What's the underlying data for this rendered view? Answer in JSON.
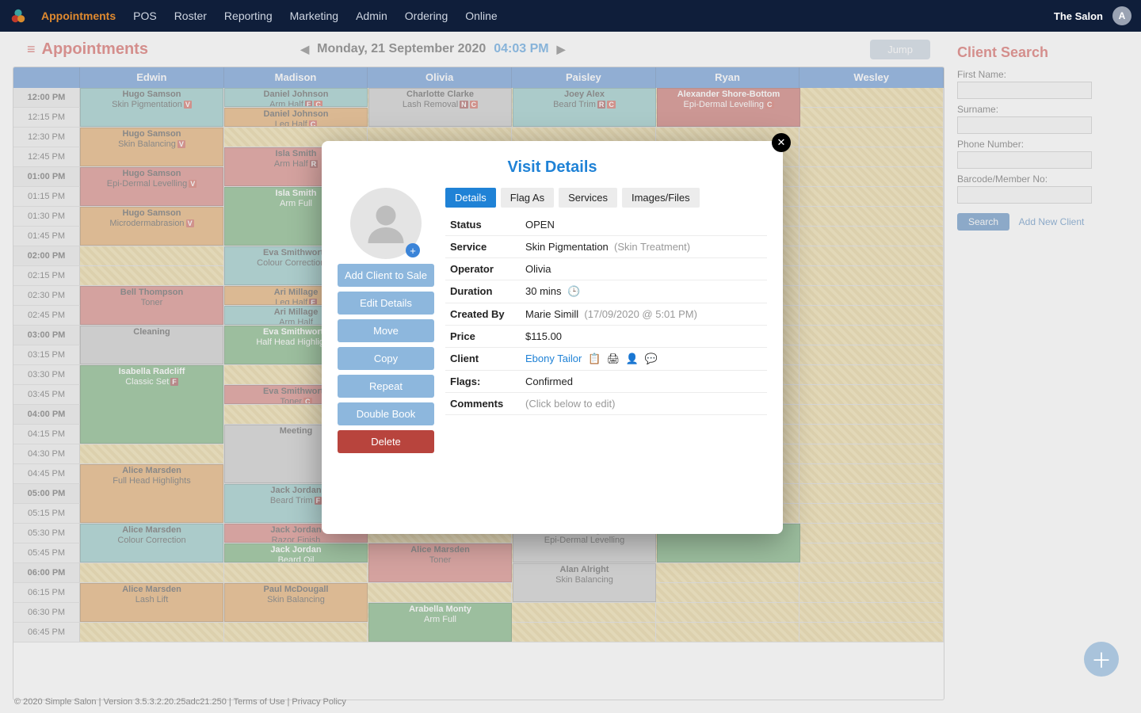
{
  "topnav": {
    "items": [
      "Appointments",
      "POS",
      "Roster",
      "Reporting",
      "Marketing",
      "Admin",
      "Ordering",
      "Online"
    ],
    "active": 0,
    "org": "The Salon",
    "avatarLetter": "A"
  },
  "pageHeader": {
    "title": "Appointments",
    "dateLabel": "Monday, 21 September 2020",
    "timeLabel": "04:03 PM",
    "jump": "Jump"
  },
  "staff": [
    "Edwin",
    "Madison",
    "Olivia",
    "Paisley",
    "Ryan",
    "Wesley"
  ],
  "timeSlots": [
    "12:00 PM",
    "12:15 PM",
    "12:30 PM",
    "12:45 PM",
    "01:00 PM",
    "01:15 PM",
    "01:30 PM",
    "01:45 PM",
    "02:00 PM",
    "02:15 PM",
    "02:30 PM",
    "02:45 PM",
    "03:00 PM",
    "03:15 PM",
    "03:30 PM",
    "03:45 PM",
    "04:00 PM",
    "04:15 PM",
    "04:30 PM",
    "04:45 PM",
    "05:00 PM",
    "05:15 PM",
    "05:30 PM",
    "05:45 PM",
    "06:00 PM",
    "06:15 PM",
    "06:30 PM",
    "06:45 PM"
  ],
  "appointments": [
    {
      "col": 0,
      "row": 0,
      "rows": 2,
      "cls": "c-teal",
      "name": "Hugo Samson",
      "svc": "Skin Pigmentation",
      "badges": [
        {
          "t": "V",
          "c": "b-red"
        }
      ]
    },
    {
      "col": 0,
      "row": 2,
      "rows": 2,
      "cls": "c-orange",
      "name": "Hugo Samson",
      "svc": "Skin Balancing",
      "badges": [
        {
          "t": "V",
          "c": "b-red"
        }
      ]
    },
    {
      "col": 0,
      "row": 4,
      "rows": 2,
      "cls": "c-red",
      "name": "Hugo Samson",
      "svc": "Epi-Dermal Levelling",
      "badges": [
        {
          "t": "V",
          "c": "b-red"
        }
      ]
    },
    {
      "col": 0,
      "row": 6,
      "rows": 2,
      "cls": "c-orange",
      "name": "Hugo Samson",
      "svc": "Microdermabrasion",
      "badges": [
        {
          "t": "V",
          "c": "b-red"
        }
      ]
    },
    {
      "col": 0,
      "row": 10,
      "rows": 2,
      "cls": "c-red",
      "name": "Bell Thompson",
      "svc": "Toner",
      "badges": []
    },
    {
      "col": 0,
      "row": 12,
      "rows": 2,
      "cls": "c-grey",
      "name": "Cleaning",
      "svc": "",
      "badges": []
    },
    {
      "col": 0,
      "row": 14,
      "rows": 4,
      "cls": "c-green",
      "name": "Isabella Radcliff",
      "svc": "Classic Set",
      "badges": [
        {
          "t": "F",
          "c": "b-dkred"
        }
      ]
    },
    {
      "col": 0,
      "row": 19,
      "rows": 3,
      "cls": "c-orange",
      "name": "Alice Marsden",
      "svc": "Full Head Highlights",
      "badges": []
    },
    {
      "col": 0,
      "row": 22,
      "rows": 2,
      "cls": "c-teal",
      "name": "Alice Marsden",
      "svc": "Colour Correction",
      "badges": []
    },
    {
      "col": 0,
      "row": 25,
      "rows": 2,
      "cls": "c-orange",
      "name": "Alice Marsden",
      "svc": "Lash Lift",
      "badges": []
    },
    {
      "col": 1,
      "row": 0,
      "rows": 1,
      "cls": "c-teal",
      "name": "Daniel Johnson",
      "svc": "Arm Half",
      "badges": [
        {
          "t": "F",
          "c": "b-dkred"
        },
        {
          "t": "C",
          "c": "b-red"
        }
      ]
    },
    {
      "col": 1,
      "row": 1,
      "rows": 1,
      "cls": "c-orange",
      "name": "Daniel Johnson",
      "svc": "Leg Half",
      "badges": [
        {
          "t": "C",
          "c": "b-red"
        }
      ]
    },
    {
      "col": 1,
      "row": 3,
      "rows": 2,
      "cls": "c-red",
      "name": "Isla Smith",
      "svc": "Arm Half",
      "badges": [
        {
          "t": "R",
          "c": "b-dkred"
        }
      ]
    },
    {
      "col": 1,
      "row": 5,
      "rows": 3,
      "cls": "c-green",
      "name": "Isla Smith",
      "svc": "Arm Full",
      "badges": []
    },
    {
      "col": 1,
      "row": 8,
      "rows": 2,
      "cls": "c-teal",
      "name": "Eva Smithworth",
      "svc": "Colour Correction",
      "badges": [
        {
          "t": "C",
          "c": "b-red"
        }
      ]
    },
    {
      "col": 1,
      "row": 10,
      "rows": 1,
      "cls": "c-orange",
      "name": "Ari Millage",
      "svc": "Leg Half",
      "badges": [
        {
          "t": "F",
          "c": "b-dkred"
        }
      ]
    },
    {
      "col": 1,
      "row": 11,
      "rows": 1,
      "cls": "c-teal",
      "name": "Ari Millage",
      "svc": "Arm Half",
      "badges": []
    },
    {
      "col": 1,
      "row": 12,
      "rows": 2,
      "cls": "c-green",
      "name": "Eva Smithworth",
      "svc": "Half Head Highlights",
      "badges": []
    },
    {
      "col": 1,
      "row": 15,
      "rows": 1,
      "cls": "c-red",
      "name": "Eva Smithworth",
      "svc": "Toner",
      "badges": [
        {
          "t": "C",
          "c": "b-red"
        }
      ]
    },
    {
      "col": 1,
      "row": 17,
      "rows": 3,
      "cls": "c-grey",
      "name": "Meeting",
      "svc": "",
      "badges": []
    },
    {
      "col": 1,
      "row": 20,
      "rows": 2,
      "cls": "c-teal",
      "name": "Jack Jordan",
      "svc": "Beard Trim",
      "badges": [
        {
          "t": "F",
          "c": "b-dkred"
        }
      ]
    },
    {
      "col": 1,
      "row": 22,
      "rows": 1,
      "cls": "c-red",
      "name": "Jack Jordan",
      "svc": "Razor Finish",
      "badges": []
    },
    {
      "col": 1,
      "row": 23,
      "rows": 1,
      "cls": "c-green",
      "name": "Jack Jordan",
      "svc": "Beard Oil",
      "badges": []
    },
    {
      "col": 1,
      "row": 25,
      "rows": 2,
      "cls": "c-orange",
      "name": "Paul McDougall",
      "svc": "Skin Balancing",
      "badges": []
    },
    {
      "col": 2,
      "row": 0,
      "rows": 2,
      "cls": "c-grey",
      "name": "Charlotte Clarke",
      "svc": "Lash Removal",
      "badges": [
        {
          "t": "N",
          "c": "b-dkred"
        },
        {
          "t": "C",
          "c": "b-red"
        }
      ]
    },
    {
      "col": 2,
      "row": 23,
      "rows": 2,
      "cls": "c-red",
      "name": "Alice Marsden",
      "svc": "Toner",
      "badges": []
    },
    {
      "col": 2,
      "row": 26,
      "rows": 2,
      "cls": "c-green",
      "name": "Arabella Monty",
      "svc": "Arm Full",
      "badges": []
    },
    {
      "col": 3,
      "row": 0,
      "rows": 2,
      "cls": "c-teal",
      "name": "Joey Alex",
      "svc": "Beard Trim",
      "badges": [
        {
          "t": "R",
          "c": "b-dkred"
        },
        {
          "t": "C",
          "c": "b-red"
        }
      ]
    },
    {
      "col": 3,
      "row": 22,
      "rows": 2,
      "cls": "c-grey",
      "name": "Alan Alright",
      "svc": "Epi-Dermal Levelling",
      "badges": []
    },
    {
      "col": 3,
      "row": 24,
      "rows": 2,
      "cls": "c-grey",
      "name": "Alan Alright",
      "svc": "Skin Balancing",
      "badges": []
    },
    {
      "col": 4,
      "row": 0,
      "rows": 2,
      "cls": "c-dkred",
      "name": "Alexander Shore-Bottom",
      "svc": "Epi-Dermal Levelling",
      "badges": [
        {
          "t": "C",
          "c": "b-red"
        }
      ]
    },
    {
      "col": 4,
      "row": 22,
      "rows": 2,
      "cls": "c-green",
      "name": "",
      "svc": "",
      "badges": []
    }
  ],
  "clientSearch": {
    "title": "Client Search",
    "fields": {
      "first": "First Name:",
      "surname": "Surname:",
      "phone": "Phone Number:",
      "barcode": "Barcode/Member No:"
    },
    "searchBtn": "Search",
    "addLink": "Add New Client"
  },
  "modal": {
    "title": "Visit Details",
    "buttons": [
      "Add Client to Sale",
      "Edit Details",
      "Move",
      "Copy",
      "Repeat",
      "Double Book",
      "Delete"
    ],
    "tabs": [
      "Details",
      "Flag As",
      "Services",
      "Images/Files"
    ],
    "activeTab": 0,
    "details": {
      "Status": "OPEN",
      "ServiceName": "Skin Pigmentation",
      "ServiceCat": "(Skin Treatment)",
      "Operator": "Olivia",
      "Duration": "30 mins",
      "CreatedBy": "Marie Simill",
      "CreatedAt": "(17/09/2020 @ 5:01 PM)",
      "Price": "$115.00",
      "ClientName": "Ebony Tailor",
      "Flags": "Confirmed",
      "CommentsLabel": "Comments",
      "CommentsHint": "(Click below to edit)"
    }
  },
  "footer": {
    "copyright": "© 2020 Simple Salon",
    "version": "Version 3.5.3.2.20.25adc21.250",
    "terms": "Terms of Use",
    "privacy": "Privacy Policy"
  }
}
